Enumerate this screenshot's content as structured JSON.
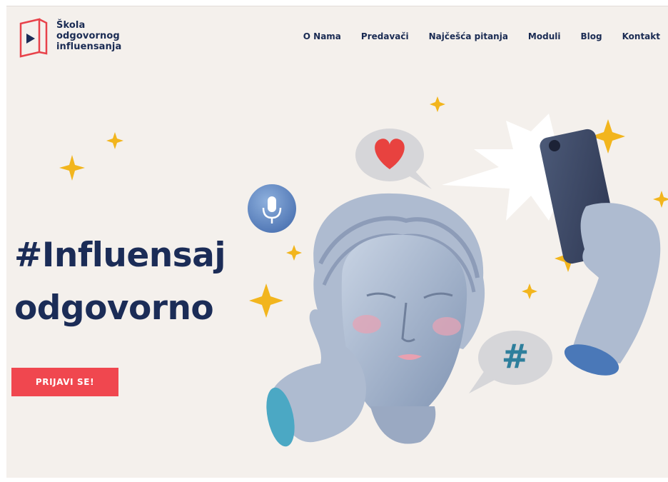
{
  "brand": {
    "line1": "Škola",
    "line2": "odgovornog",
    "line3": "influensanja",
    "logo_icon": "play-book-icon",
    "logo_color": "#e8424a"
  },
  "nav": {
    "items": [
      "O Nama",
      "Predavači",
      "Najčešća pitanja",
      "Moduli",
      "Blog",
      "Kontakt"
    ]
  },
  "hero": {
    "title_line1": "#Influensaj",
    "title_line2": "odgovorno",
    "cta_label": "PRIJAVI SE!",
    "hashtag_bubble": "#"
  },
  "colors": {
    "background": "#f4f0ec",
    "navy": "#1b2c57",
    "accent_red": "#f0474f",
    "star_gold": "#f2b51d"
  }
}
